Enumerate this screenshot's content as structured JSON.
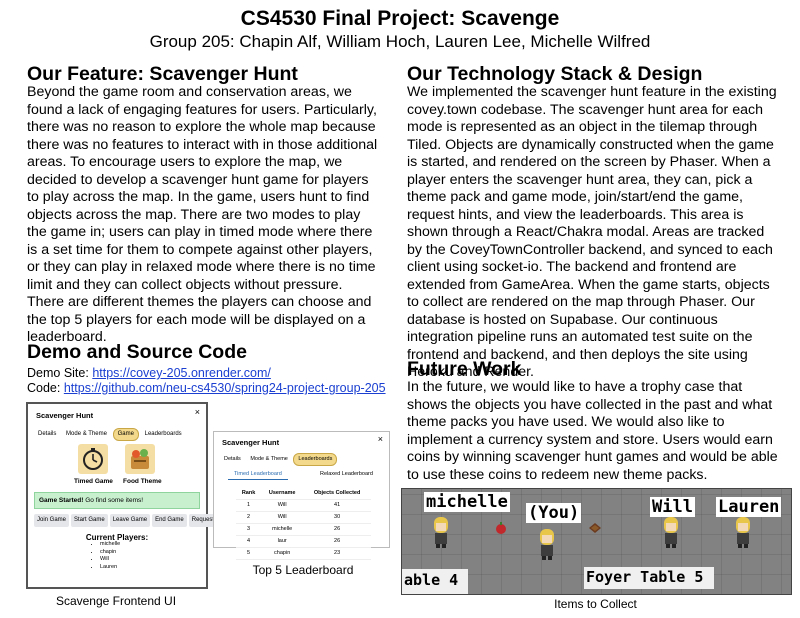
{
  "title": "CS4530 Final Project: Scavenge",
  "authors": "Group 205: Chapin Alf, William Hoch, Lauren Lee, Michelle Wilfred",
  "feature": {
    "heading": "Our Feature: Scavenger Hunt",
    "body": "Beyond the game room and conservation areas, we found a lack of engaging features for users. Particularly, there was no reason to explore the whole map because there was no features to interact with in those additional areas. To encourage users to explore the map, we decided to develop a scavenger hunt game for players to play across the map. In the game, users hunt to find objects across the map. There are two modes to play the game in; users can play in timed mode where there is a set time for them to compete against other players, or they can play in relaxed mode where there is no time limit and they can collect objects without pressure. There are different themes the players can choose and the top 5 players for each mode will be displayed on a leaderboard."
  },
  "demo": {
    "heading": "Demo and Source Code",
    "site_label": "Demo Site: ",
    "site_url": "https://covey-205.onrender.com/",
    "code_label": "Code: ",
    "code_url": "https://github.com/neu-cs4530/spring24-project-group-205"
  },
  "tech": {
    "heading": "Our Technology Stack & Design",
    "body": "We implemented the scavenger hunt feature in the existing covey.town codebase. The scavenger hunt area for each mode is represented as an object in the tilemap through Tiled. Objects are dynamically constructed when the game is started, and rendered on the screen by Phaser. When a player enters the scavenger hunt area, they can, pick a theme pack and game mode, join/start/end the game, request hints, and view the leaderboards. This area is shown through a React/Chakra modal. Areas are tracked by the CoveyTownController backend, and synced to each client using socket-io. The backend and frontend are extended from GameArea. When the game starts, objects to collect are rendered on the map through Phaser. Our database is hosted on Supabase. Our continuous integration pipeline runs an automated test suite on the frontend and backend, and then deploys the site using Heroku and Render."
  },
  "future": {
    "heading": "Future Work",
    "body": "In the future, we would like to have a trophy case that shows the objects you have collected in the past and what theme packs you have used. We would also like to implement a currency system and store. Users would earn coins by winning scavenger hunt games and would be able to use these coins to redeem new theme packs."
  },
  "frontend_ui": {
    "title": "Scavenger Hunt",
    "close": "×",
    "tabs": [
      "Details",
      "Mode & Theme",
      "Game",
      "Leaderboards"
    ],
    "active_tab": "Game",
    "modes": [
      "Timed Game",
      "Food Theme"
    ],
    "banner_bold": "Game Started!",
    "banner_text": " Go find some items!",
    "buttons": [
      "Join Game",
      "Start Game",
      "Leave Game",
      "End Game",
      "Request Hint"
    ],
    "players_heading": "Current Players:",
    "players": [
      "michelle",
      "chapin",
      "Will",
      "Lauren"
    ],
    "caption": "Scavenge Frontend UI"
  },
  "leaderboard_ui": {
    "title": "Scavenger Hunt",
    "close": "×",
    "tabs": [
      "Details",
      "Mode & Theme",
      "Leaderboards"
    ],
    "subtabs": [
      "Timed Leaderboard",
      "Relaxed Leaderboard"
    ],
    "columns": [
      "Rank",
      "Username",
      "Objects Collected"
    ],
    "rows": [
      [
        "1",
        "Will",
        "41"
      ],
      [
        "2",
        "Will",
        "30"
      ],
      [
        "3",
        "michelle",
        "26"
      ],
      [
        "4",
        "laur",
        "26"
      ],
      [
        "5",
        "chapin",
        "23"
      ]
    ],
    "caption": "Top 5 Leaderboard"
  },
  "game_view": {
    "names": [
      "michelle",
      "(You)",
      "Will",
      "Lauren"
    ],
    "tables": [
      "able 4",
      "Foyer Table 5"
    ],
    "caption": "Items to Collect",
    "colors": {
      "floor": "#b9b9b9",
      "bg": "#9a9a9a",
      "hair": "#e8c64a",
      "item_red": "#c0282b"
    }
  }
}
